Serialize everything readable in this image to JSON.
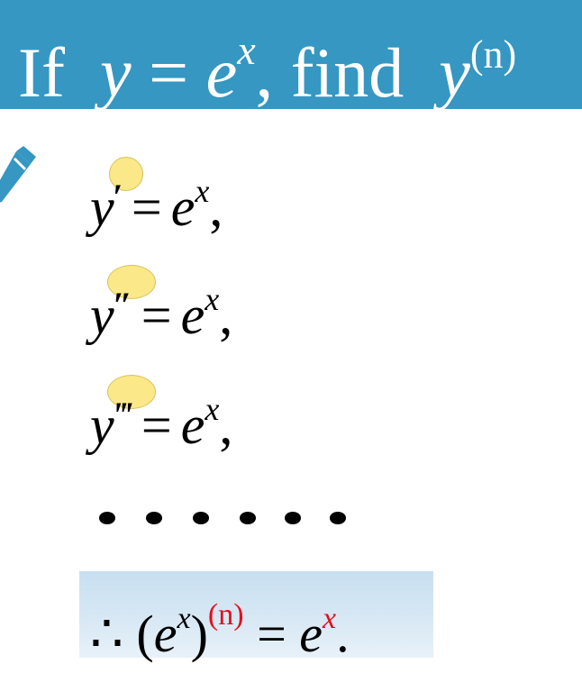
{
  "header": {
    "word_if": "If",
    "var_y": "y",
    "eq": "=",
    "base_e": "e",
    "exp_x": "x",
    "comma_find": ", find",
    "deriv_y": "y",
    "deriv_order": "(n)"
  },
  "colors": {
    "banner": "#3597c2",
    "highlight": "#fbe889",
    "result_box": "#d3e5f3",
    "accent_red": "#e3101a"
  },
  "steps": [
    {
      "y": "y",
      "prime": "′",
      "eq": "=",
      "e": "e",
      "x": "x",
      "comma": ","
    },
    {
      "y": "y",
      "prime": "″",
      "eq": "=",
      "e": "e",
      "x": "x",
      "comma": ","
    },
    {
      "y": "y",
      "prime": "‴",
      "eq": "=",
      "e": "e",
      "x": "x",
      "comma": ","
    }
  ],
  "result": {
    "therefore": "∴",
    "open": "(",
    "e": "e",
    "x": "x",
    "close": ")",
    "order": "(n)",
    "eq": "=",
    "rhs_e": "e",
    "rhs_x": "x",
    "period": "."
  },
  "icons": {
    "pencil": "pencil-icon"
  }
}
